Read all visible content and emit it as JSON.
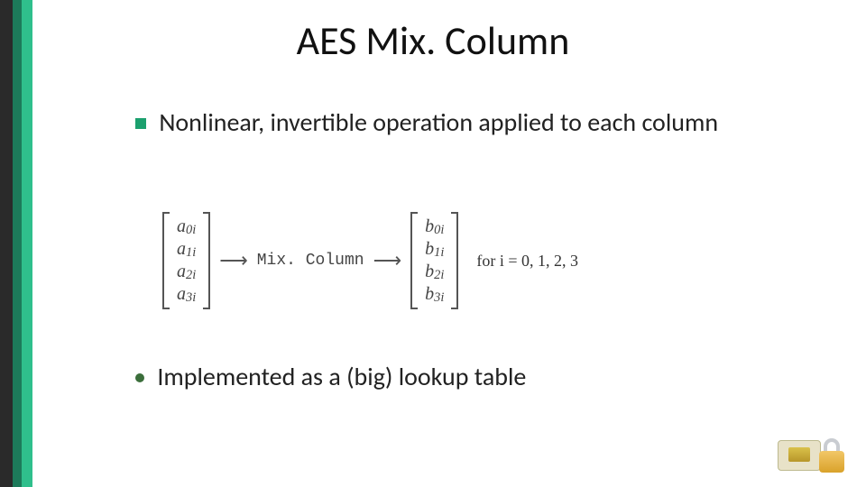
{
  "title": "AES Mix. Column",
  "bullet1": "Nonlinear, invertible operation applied to each column",
  "bullet2": "Implemented as a (big) lookup table",
  "eq": {
    "a": [
      "a",
      "a",
      "a",
      "a"
    ],
    "a_sub": [
      "0i",
      "1i",
      "2i",
      "3i"
    ],
    "op": "Mix. Column",
    "b": [
      "b",
      "b",
      "b",
      "b"
    ],
    "b_sub": [
      "0i",
      "1i",
      "2i",
      "3i"
    ],
    "for": "for i = 0, 1, 2, 3"
  },
  "icons": {
    "chip": "chip-icon",
    "lock": "lock-icon"
  }
}
